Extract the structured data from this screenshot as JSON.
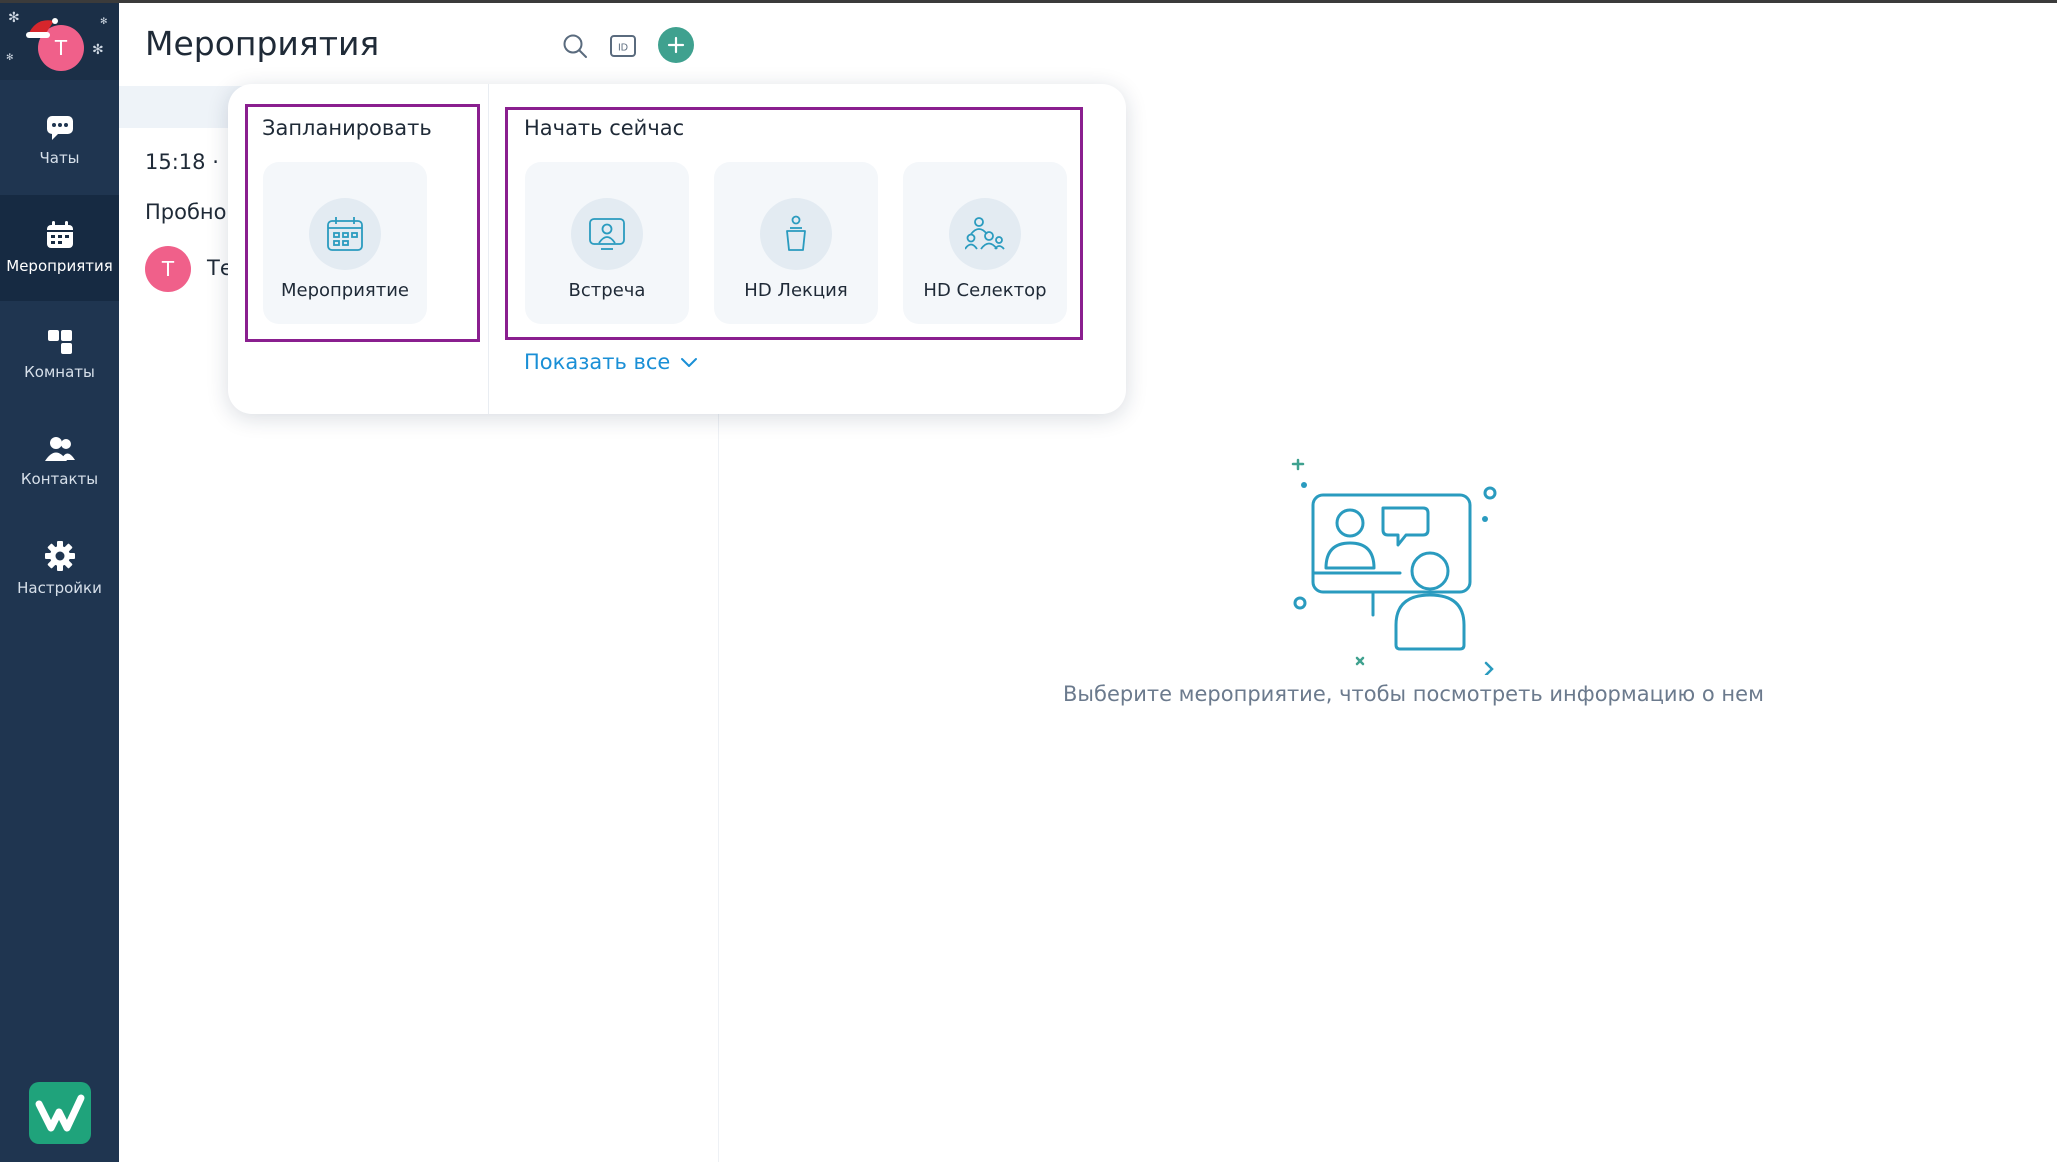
{
  "avatar_initial": "T",
  "sidebar": {
    "items": [
      {
        "label": "Чаты",
        "icon": "chat-icon"
      },
      {
        "label": "Мероприятия",
        "icon": "calendar-icon",
        "active": true
      },
      {
        "label": "Комнаты",
        "icon": "rooms-icon"
      },
      {
        "label": "Контакты",
        "icon": "contacts-icon"
      },
      {
        "label": "Настройки",
        "icon": "gear-icon"
      }
    ]
  },
  "header": {
    "title": "Мероприятия",
    "icons": [
      "search-icon",
      "id-icon",
      "plus-icon"
    ]
  },
  "event_list": {
    "time": "15:18 ·",
    "title": "Пробно",
    "avatar_initial": "T",
    "user": "Те"
  },
  "popup": {
    "schedule": {
      "title": "Запланировать",
      "cards": [
        {
          "label": "Мероприятие",
          "icon": "calendar-grid-icon"
        }
      ]
    },
    "start_now": {
      "title": "Начать сейчас",
      "cards": [
        {
          "label": "Встреча",
          "icon": "meeting-icon"
        },
        {
          "label": "HD Лекция",
          "icon": "lecture-icon"
        },
        {
          "label": "HD Селектор",
          "icon": "selector-icon"
        }
      ]
    },
    "show_all": "Показать все"
  },
  "empty_state": {
    "text": "Выберите мероприятие, чтобы посмотреть информацию о нем",
    "icon": "video-conference-illustration"
  },
  "colors": {
    "sidebar": "#1f3550",
    "accent": "#3fa18f",
    "link": "#1a8fd6",
    "highlight_box": "#8a1f8f",
    "avatar": "#f0608a"
  }
}
